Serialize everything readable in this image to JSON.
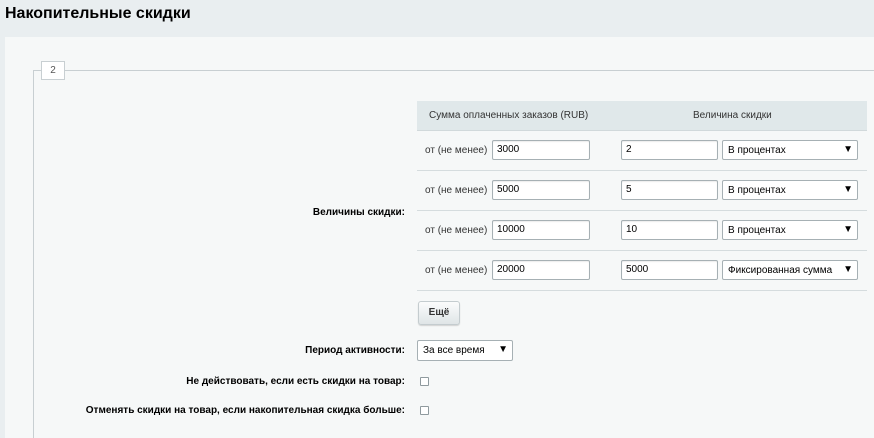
{
  "page": {
    "title": "Накопительные скидки"
  },
  "tab": {
    "label": "2"
  },
  "discounts": {
    "label": "Величины скидки:",
    "header": {
      "sum_col": "Сумма оплаченных заказов (RUB)",
      "value_col": "Величина скидки"
    },
    "from_label": "от (не менее)",
    "rows": [
      {
        "sum": "3000",
        "value": "2",
        "type": "В процентах"
      },
      {
        "sum": "5000",
        "value": "5",
        "type": "В процентах"
      },
      {
        "sum": "10000",
        "value": "10",
        "type": "В процентах"
      },
      {
        "sum": "20000",
        "value": "5000",
        "type": "Фиксированная сумма"
      }
    ],
    "more_button": "Ещё"
  },
  "period": {
    "label": "Период активности:",
    "value": "За все время"
  },
  "option1": {
    "label": "Не действовать, если есть скидки на товар:",
    "checked": false
  },
  "option2": {
    "label": "Отменять скидки на товар, если накопительная скидка больше:",
    "checked": false
  },
  "icons": {
    "dropdown": "triangle-down-icon"
  }
}
